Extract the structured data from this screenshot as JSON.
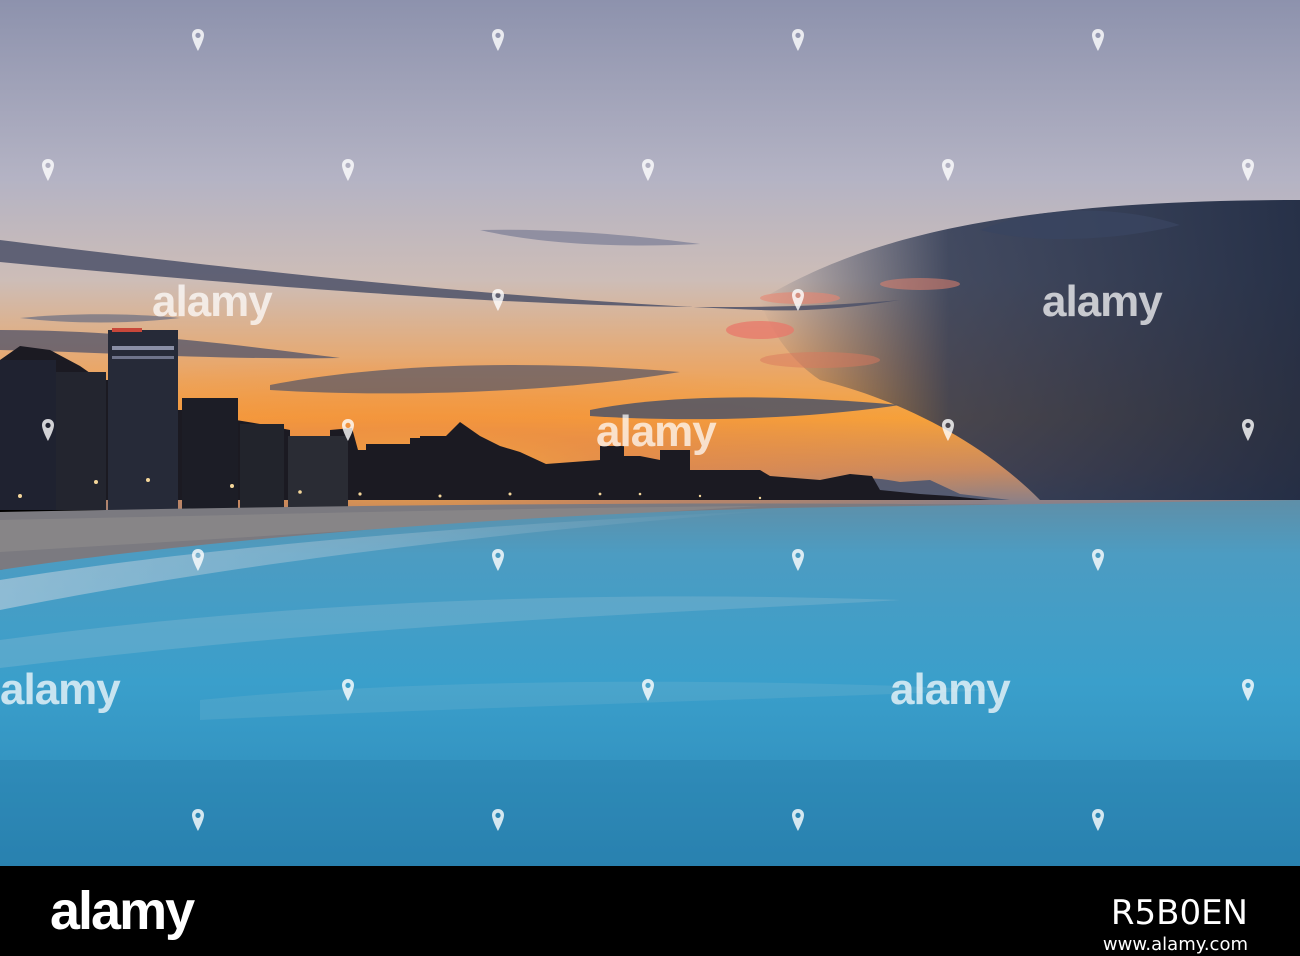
{
  "watermark": {
    "text": "alamy"
  },
  "banner": {
    "logo": "alamy",
    "image_id": "R5B0EN",
    "site": "www.alamy.com"
  },
  "colors": {
    "sky_top": "#8f93ad",
    "sky_glow": "#f09a3e",
    "sea": "#3a9cc6",
    "banner_bg": "#000000"
  },
  "icons": [
    "pin-icon"
  ]
}
